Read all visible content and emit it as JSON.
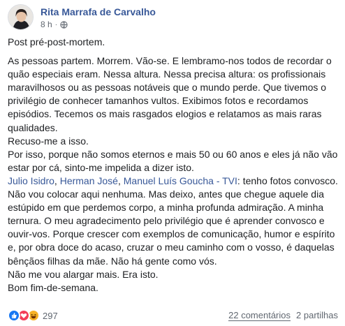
{
  "post": {
    "author": "Rita Marrafa de Carvalho",
    "time": "8 h",
    "audience_icon": "globe-icon",
    "title_line": "Post pré-post-mortem.",
    "paragraph1": "As pessoas partem. Morrem. Vão-se. E lembramo-nos todos de recordar o quão especiais eram. Nessa altura. Nessa precisa altura: os profissionais maravilhosos ou as pessoas notáveis que o mundo perde. Que tivemos o privilégio de conhecer tamanhos vultos. Exibimos fotos e recordamos episódios. Tecemos os mais rasgados elogios e relatamos as mais raras qualidades.",
    "line_refuse": "Recuso-me a isso.",
    "paragraph2": "Por isso, porque não somos eternos e mais 50 ou 60 anos e eles já não vão estar por cá, sinto-me impelida a dizer isto.",
    "mentions": [
      {
        "name": "Julio Isidro"
      },
      {
        "name": "Herman José"
      },
      {
        "name": "Manuel Luís Goucha - TVI"
      }
    ],
    "mention_sep": ", ",
    "mention_tail": ": tenho fotos convosco. Não vou colocar aqui nenhuma. Mas deixo, antes que chegue aquele dia estúpido em que perdemos corpo, a minha profunda admiração. A minha ternura. O meu agradecimento pelo privilégio que é aprender convosco e ouvir-vos. Porque crescer com exemplos de comunicação, humor e espírito e, por obra doce do acaso, cruzar o meu caminho com o vosso, é daquelas bênçãos filhas da mãe. Não há gente como vós.",
    "line_widen": "Não me vou alargar mais. Era isto.",
    "line_weekend": "Bom fim-de-semana."
  },
  "footer": {
    "reaction_icons": [
      "like-icon",
      "love-icon",
      "haha-icon"
    ],
    "reaction_count": "297",
    "comments": "22 comentários",
    "shares": "2 partilhas"
  }
}
